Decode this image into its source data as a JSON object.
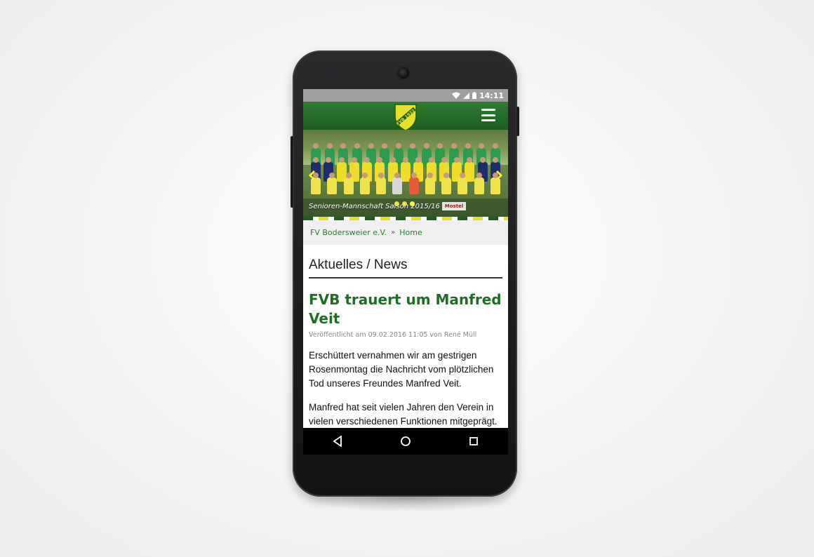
{
  "status_bar": {
    "time": "14:11"
  },
  "app_bar": {
    "logo_text": "FVB 1932"
  },
  "hero": {
    "caption": "Senioren-Mannschaft Saison 2015/16",
    "sponsor": "Mostel",
    "prev_icon": "chevron-left-icon",
    "next_icon": "chevron-right-icon",
    "slides": 3,
    "active_slide": 3
  },
  "breadcrumb": {
    "root": "FV Bodersweier e.V.",
    "current": "Home"
  },
  "section": {
    "title": "Aktuelles / News"
  },
  "post": {
    "title": "FVB trauert um Manfred Veit",
    "meta": "Veröffentlicht am 09.02.2016 11:05 von René Müll",
    "paragraph1": "Erschüttert vernahmen wir am gestrigen Rosenmontag die Nachricht vom plötzlichen Tod unseres Freundes Manfred Veit.",
    "paragraph2": "Manfred hat seit vielen Jahren den Verein in vielen verschiedenen Funktionen mitgeprägt."
  },
  "colors": {
    "brand_green": "#1b5e20",
    "brand_yellow": "#e4e02a",
    "title_green": "#1f6e25"
  }
}
